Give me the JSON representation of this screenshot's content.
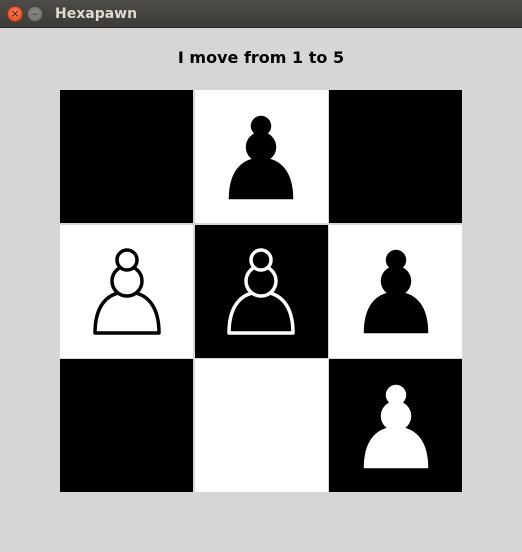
{
  "window": {
    "title": "Hexapawn",
    "close_symbol": "×",
    "minimize_symbol": "–"
  },
  "status_message": "I move from 1 to 5",
  "board": {
    "rows": 3,
    "cols": 3,
    "cells": [
      {
        "index": 0,
        "square": "dark",
        "piece": "none"
      },
      {
        "index": 1,
        "square": "light",
        "piece": "black-pawn"
      },
      {
        "index": 2,
        "square": "dark",
        "piece": "none"
      },
      {
        "index": 3,
        "square": "light",
        "piece": "white-pawn"
      },
      {
        "index": 4,
        "square": "dark",
        "piece": "black-pawn"
      },
      {
        "index": 5,
        "square": "light",
        "piece": "black-pawn"
      },
      {
        "index": 6,
        "square": "dark",
        "piece": "none"
      },
      {
        "index": 7,
        "square": "light",
        "piece": "none"
      },
      {
        "index": 8,
        "square": "dark",
        "piece": "white-pawn"
      }
    ]
  },
  "colors": {
    "dark_square": "#000000",
    "light_square": "#ffffff",
    "background": "#d6d6d6",
    "titlebar": "#3c3b37"
  }
}
